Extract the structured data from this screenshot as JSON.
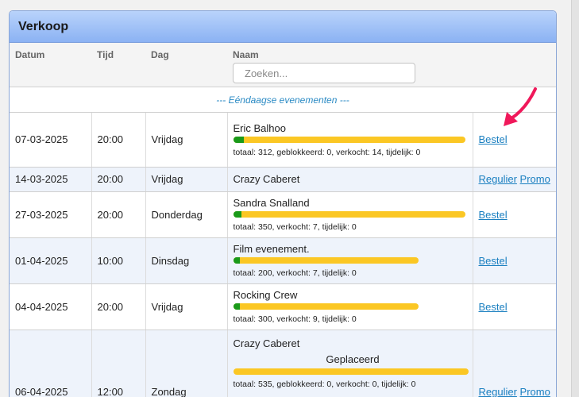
{
  "panel": {
    "title": "Verkoop"
  },
  "columns": {
    "date": "Datum",
    "time": "Tijd",
    "day": "Dag",
    "name": "Naam"
  },
  "search": {
    "placeholder": "Zoeken..."
  },
  "section": {
    "one_day": "--- Eéndaagse evenementen ---"
  },
  "colors": {
    "bar": "#fbc724",
    "sold": "#1a9a1a",
    "link": "#1a7fc0",
    "header": "#8bb2f3",
    "arrow": "#f0185a"
  },
  "rows": [
    {
      "date": "07-03-2025",
      "time": "20:00",
      "day": "Vrijdag",
      "name": "Eric Balhoo",
      "stats": "totaal: 312, geblokkeerd: 0, verkocht: 14, tijdelijk: 0",
      "sold_fraction": 0.045,
      "actions": [
        "Bestel"
      ]
    },
    {
      "date": "14-03-2025",
      "time": "20:00",
      "day": "Vrijdag",
      "name": "Crazy Caberet",
      "actions": [
        "Regulier",
        "Promo"
      ]
    },
    {
      "date": "27-03-2025",
      "time": "20:00",
      "day": "Donderdag",
      "name": "Sandra Snalland",
      "stats": "totaal: 350, verkocht: 7, tijdelijk: 0",
      "sold_fraction": 0.02,
      "actions": [
        "Bestel"
      ]
    },
    {
      "date": "01-04-2025",
      "time": "10:00",
      "day": "Dinsdag",
      "name": "Film evenement.",
      "stats": "totaal: 200, verkocht: 7, tijdelijk: 0",
      "sold_fraction": 0.035,
      "actions": [
        "Bestel"
      ]
    },
    {
      "date": "04-04-2025",
      "time": "20:00",
      "day": "Vrijdag",
      "name": "Rocking Crew",
      "stats": "totaal: 300, verkocht: 9, tijdelijk: 0",
      "sold_fraction": 0.03,
      "actions": [
        "Bestel"
      ]
    },
    {
      "date": "06-04-2025",
      "time": "12:00",
      "day": "Zondag",
      "name": "Crazy Caberet",
      "placed": "Geplaceerd",
      "stats": "totaal: 535, geblokkeerd: 0, verkocht: 0, tijdelijk: 0",
      "sold_fraction": 0,
      "actions": [
        "Regulier",
        "Promo"
      ]
    }
  ]
}
